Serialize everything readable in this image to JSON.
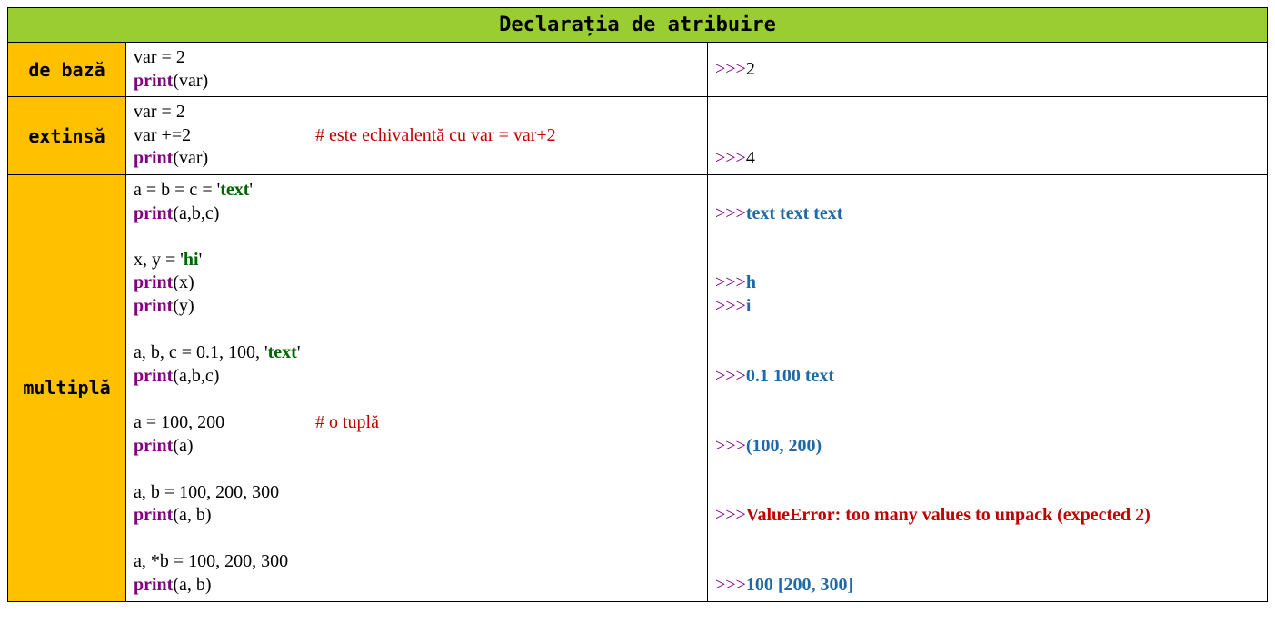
{
  "header": {
    "title": "Declarația de atribuire"
  },
  "row_labels": {
    "basic": "de bază",
    "extended": "extinsă",
    "multiple": "multiplă"
  },
  "code": {
    "r1_l1": "var = 2",
    "r1_l2_kw": "print",
    "r1_l2_rest": "(var)",
    "r2_l1": "var = 2",
    "r2_l2a": "var +=2",
    "r2_l2_cmt": "# este echivalentă cu var = var+2",
    "r2_l3_kw": "print",
    "r2_l3_rest": "(var)",
    "r3_l1a": "a = b = c = '",
    "r3_l1_str": "text",
    "r3_l1b": "'",
    "r3_l2_kw": "print",
    "r3_l2_rest": "(a,b,c)",
    "r3_l4a": "x, y = '",
    "r3_l4_str": "hi",
    "r3_l4b": "'",
    "r3_l5_kw": "print",
    "r3_l5_rest": "(x)",
    "r3_l6_kw": "print",
    "r3_l6_rest": "(y)",
    "r3_l8a": "a, b, c = 0.1, 100, '",
    "r3_l8_str": "text",
    "r3_l8b": "'",
    "r3_l9_kw": "print",
    "r3_l9_rest": "(a,b,c)",
    "r3_l11a": "a = 100, 200",
    "r3_l11_cmt": "# o tuplă",
    "r3_l12_kw": "print",
    "r3_l12_rest": "(a)",
    "r3_l14": "a, b = 100, 200, 300",
    "r3_l15_kw": "print",
    "r3_l15_rest": "(a, b)",
    "r3_l17": "a, *b = 100, 200, 300",
    "r3_l18_kw": "print",
    "r3_l18_rest": "(a, b)"
  },
  "out": {
    "prompt": ">>>",
    "r1": "2",
    "r2": "4",
    "r3_1": "text text text",
    "r3_2": "h",
    "r3_3": "i",
    "r3_4": "0.1 100 text",
    "r3_5": "(100, 200)",
    "r3_6": "ValueError: too many values to unpack (expected 2)",
    "r3_7": "100 [200, 300]"
  }
}
